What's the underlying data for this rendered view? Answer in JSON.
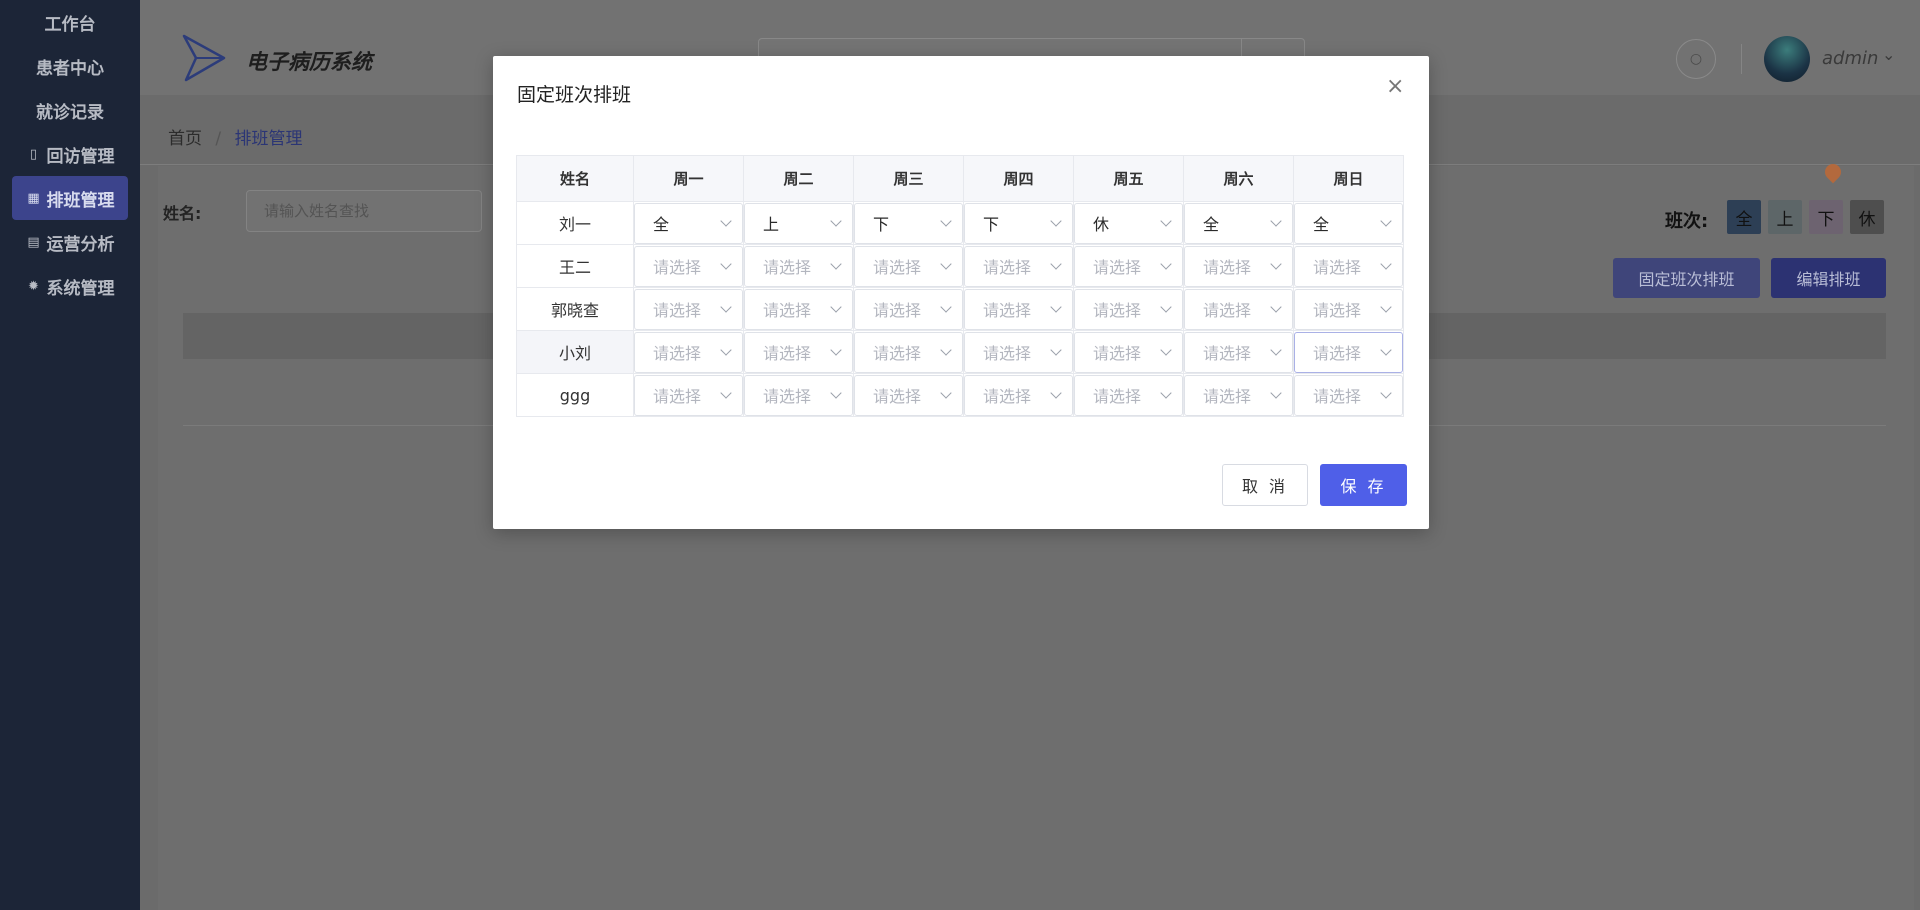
{
  "sidebar": {
    "items": [
      {
        "label": "工作台",
        "icon": ""
      },
      {
        "label": "患者中心",
        "icon": ""
      },
      {
        "label": "就诊记录",
        "icon": ""
      },
      {
        "label": "回访管理",
        "icon": "phone-icon"
      },
      {
        "label": "排班管理",
        "icon": "calendar-icon",
        "active": true
      },
      {
        "label": "运营分析",
        "icon": "monitor-icon"
      },
      {
        "label": "系统管理",
        "icon": "gear-icon"
      }
    ]
  },
  "header": {
    "title": "电子病历系统",
    "user": "admin"
  },
  "breadcrumb": {
    "home": "首页",
    "separator": "/",
    "current": "排班管理"
  },
  "filter": {
    "name_label": "姓名:",
    "name_placeholder": "请输入姓名查找"
  },
  "shift_legend": {
    "label": "班次:",
    "items": [
      {
        "label": "全",
        "color": "#2d3f55"
      },
      {
        "label": "上",
        "color": "#5d6668"
      },
      {
        "label": "下",
        "color": "#6d6370"
      },
      {
        "label": "休",
        "color": "#4e4e4e"
      }
    ]
  },
  "actions": {
    "fixed_schedule": "固定班次排班",
    "edit_schedule": "编辑排班"
  },
  "modal": {
    "title": "固定班次排班",
    "columns": [
      "姓名",
      "周一",
      "周二",
      "周三",
      "周四",
      "周五",
      "周六",
      "周日"
    ],
    "placeholder": "请选择",
    "rows": [
      {
        "name": "刘一",
        "shifts": [
          "全",
          "上",
          "下",
          "下",
          "休",
          "全",
          "全"
        ]
      },
      {
        "name": "王二",
        "shifts": [
          "",
          "",
          "",
          "",
          "",
          "",
          ""
        ]
      },
      {
        "name": "郭晓查",
        "shifts": [
          "",
          "",
          "",
          "",
          "",
          "",
          ""
        ]
      },
      {
        "name": "小刘",
        "shifts": [
          "",
          "",
          "",
          "",
          "",
          "",
          ""
        ]
      },
      {
        "name": "ggg",
        "shifts": [
          "",
          "",
          "",
          "",
          "",
          "",
          ""
        ]
      }
    ],
    "cancel": "取 消",
    "save": "保 存"
  },
  "colors": {
    "primary": "#4f5fe8",
    "sidebar_bg": "#1c2537"
  }
}
